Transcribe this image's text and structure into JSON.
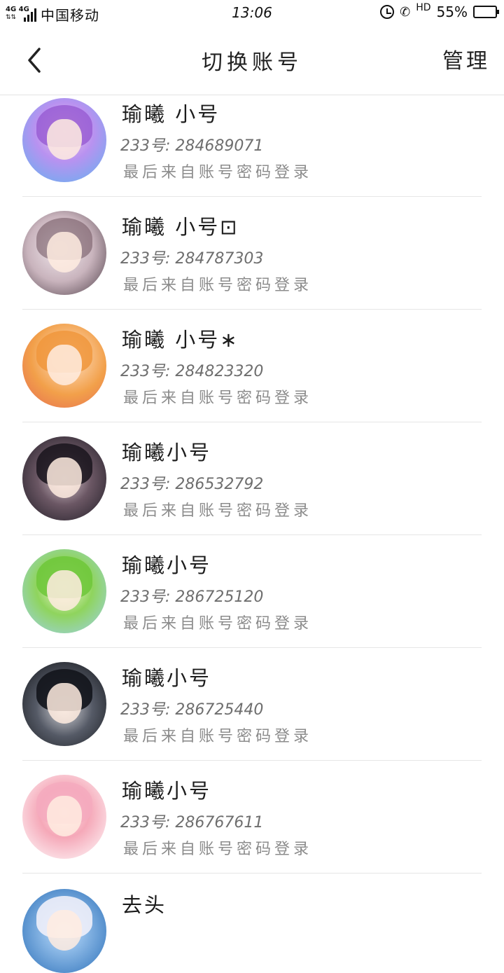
{
  "status_bar": {
    "network": "4G 4G",
    "arrows": "⇅⇅",
    "carrier": "中国移动",
    "time": "13:06",
    "hd": "HD",
    "battery_percent": "55%",
    "battery_level": 0.55
  },
  "header": {
    "title": "切换账号",
    "manage_label": "管理"
  },
  "accounts": [
    {
      "name": "瑜曦 小号",
      "id": "233号: 284689071",
      "login": "最后来自账号密码登录"
    },
    {
      "name": "瑜曦  小号⊡",
      "id": "233号: 284787303",
      "login": "最后来自账号密码登录"
    },
    {
      "name": "瑜曦  小号∗",
      "id": "233号: 284823320",
      "login": "最后来自账号密码登录"
    },
    {
      "name": "瑜曦小号",
      "id": "233号: 286532792",
      "login": "最后来自账号密码登录"
    },
    {
      "name": "瑜曦小号",
      "id": "233号: 286725120",
      "login": "最后来自账号密码登录"
    },
    {
      "name": "瑜曦小号",
      "id": "233号: 286725440",
      "login": "最后来自账号密码登录"
    },
    {
      "name": "瑜曦小号",
      "id": "233号: 286767611",
      "login": "最后来自账号密码登录"
    }
  ],
  "partial_account": {
    "name": "去头"
  }
}
